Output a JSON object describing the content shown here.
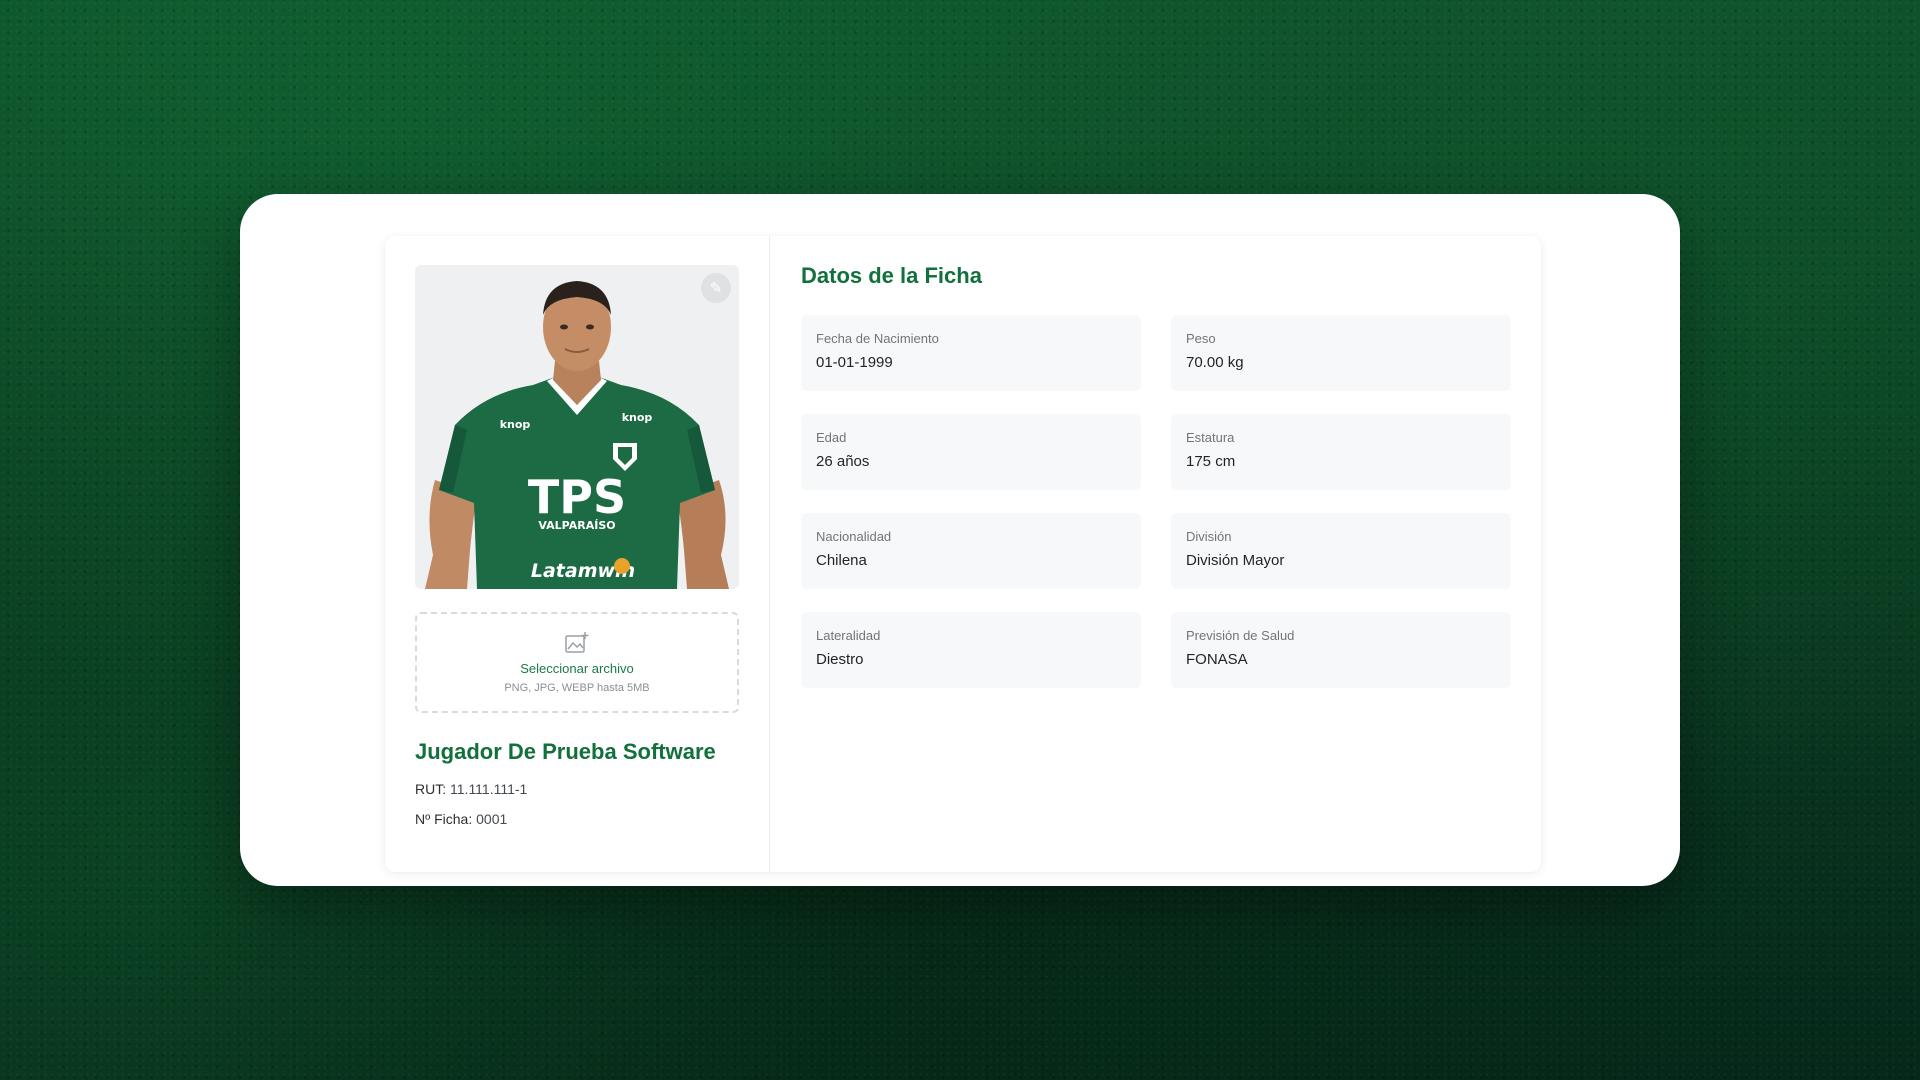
{
  "profile": {
    "edit_icon": "pencil-icon",
    "upload": {
      "icon": "image-add-icon",
      "label": "Seleccionar archivo",
      "hint": "PNG, JPG, WEBP hasta 5MB"
    },
    "name": "Jugador De Prueba Software",
    "rut_label": "RUT:",
    "rut_value": "11.111.111-1",
    "ficha_label": "Nº Ficha:",
    "ficha_value": "0001",
    "jersey": {
      "sponsor": "TPS",
      "sponsor_sub": "VALPARAÍSO",
      "brand": "knop",
      "brand_right": "knop",
      "front_sponsor": "Latamwin",
      "color": "#1d6b45"
    }
  },
  "details": {
    "title": "Datos de la Ficha",
    "fields": [
      {
        "label": "Fecha de Nacimiento",
        "value": "01-01-1999"
      },
      {
        "label": "Peso",
        "value": "70.00 kg"
      },
      {
        "label": "Edad",
        "value": "26 años"
      },
      {
        "label": "Estatura",
        "value": "175 cm"
      },
      {
        "label": "Nacionalidad",
        "value": "Chilena"
      },
      {
        "label": "División",
        "value": "División Mayor"
      },
      {
        "label": "Lateralidad",
        "value": "Diestro"
      },
      {
        "label": "Previsión de Salud",
        "value": "FONASA"
      }
    ]
  },
  "colors": {
    "accent": "#12703c",
    "background": "#0a3b20"
  }
}
